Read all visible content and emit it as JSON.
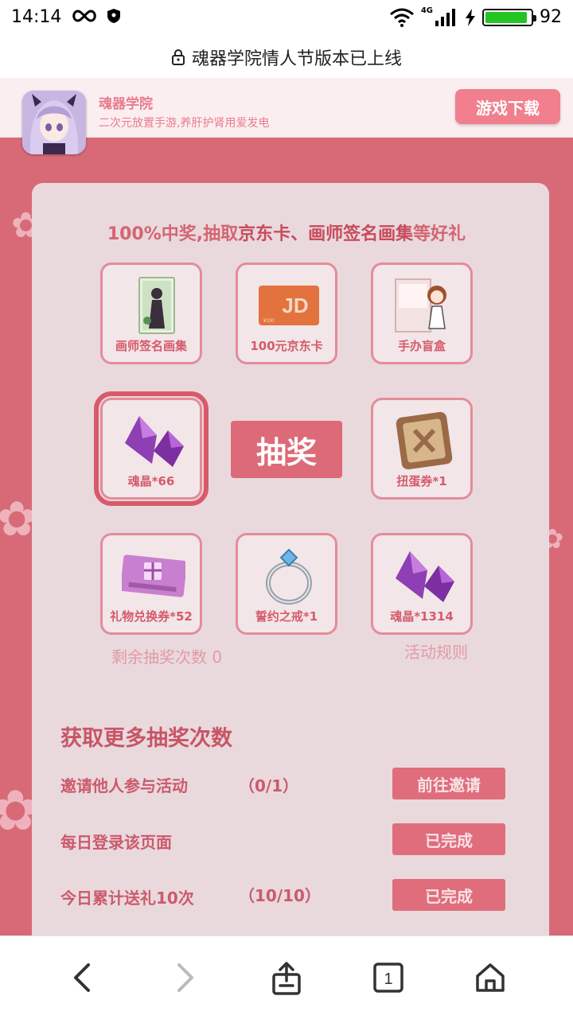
{
  "status_bar": {
    "time": "14:14",
    "network": "4G",
    "battery": "92",
    "battery_color": "#22c522",
    "icons": [
      "infinity-icon",
      "shield-icon",
      "wifi-icon",
      "signal-icon",
      "charging-icon",
      "battery-icon"
    ]
  },
  "address_bar": {
    "title": "魂器学院情人节版本已上线",
    "icon": "lock-icon"
  },
  "app_banner": {
    "name": "魂器学院",
    "description": "二次元放置手游,养肝护肾用爱发电",
    "download_label": "游戏下载"
  },
  "lottery": {
    "headline_prefix": "100%中奖,抽取",
    "headline_highlight": "京东卡、画师签名画集",
    "headline_suffix": "等好礼",
    "draw_label": "抽奖",
    "remaining_text": "剩余抽奖次数 0",
    "rules_label": "活动规则",
    "prizes": [
      {
        "label": "画师签名画集",
        "icon": "artbook-icon"
      },
      {
        "label": "100元京东卡",
        "icon": "jd-card-icon"
      },
      {
        "label": "手办盲盒",
        "icon": "figure-box-icon"
      },
      {
        "label": "魂晶*66",
        "icon": "crystal-icon"
      },
      {
        "label": "扭蛋券*1",
        "icon": "gacha-ticket-icon"
      },
      {
        "label": "礼物兑换券*52",
        "icon": "gift-voucher-icon"
      },
      {
        "label": "誓约之戒*1",
        "icon": "ring-icon"
      },
      {
        "label": "魂晶*1314",
        "icon": "crystal-icon"
      }
    ],
    "jd_card_text": "JD",
    "jd_card_value": "¥100"
  },
  "tasks": {
    "title": "获取更多抽奖次数",
    "items": [
      {
        "name": "邀请他人参与活动",
        "progress": "（0/1）",
        "button": "前往邀请"
      },
      {
        "name": "每日登录该页面",
        "progress": "",
        "button": "已完成"
      },
      {
        "name": "今日累计送礼10次",
        "progress": "（10/10）",
        "button": "已完成"
      }
    ]
  },
  "bottom_nav": {
    "tab_count": "1",
    "items": [
      "back-icon",
      "forward-icon",
      "share-icon",
      "tabs-icon",
      "home-icon"
    ]
  },
  "colors": {
    "page_bg": "#d86a78",
    "card_bg": "#e9d9dd",
    "accent": "#e06d7b",
    "download_btn": "#f17f8e"
  }
}
